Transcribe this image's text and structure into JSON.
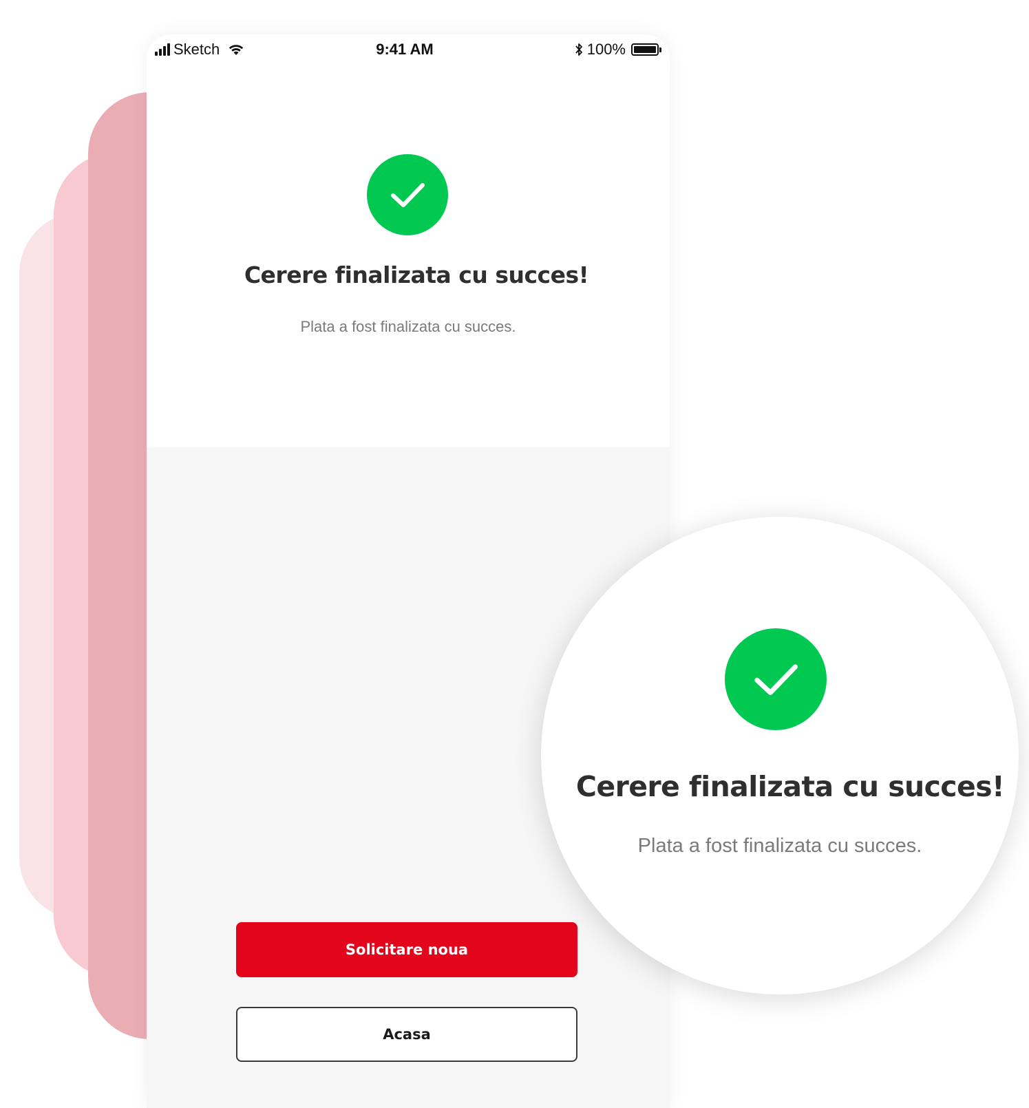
{
  "status_bar": {
    "carrier": "Sketch",
    "time": "9:41 AM",
    "battery": "100%"
  },
  "success": {
    "title": "Cerere finalizata cu succes!",
    "message": "Plata a fost finalizata cu succes."
  },
  "actions": {
    "primary_label": "Solicitare noua",
    "secondary_label": "Acasa"
  },
  "colors": {
    "brand_red": "#e3051b",
    "success_green": "#00c851",
    "deco_pink_1": "#ebadb4",
    "deco_pink_2": "#f8c9d1",
    "deco_pink_3": "#fae3e7"
  }
}
